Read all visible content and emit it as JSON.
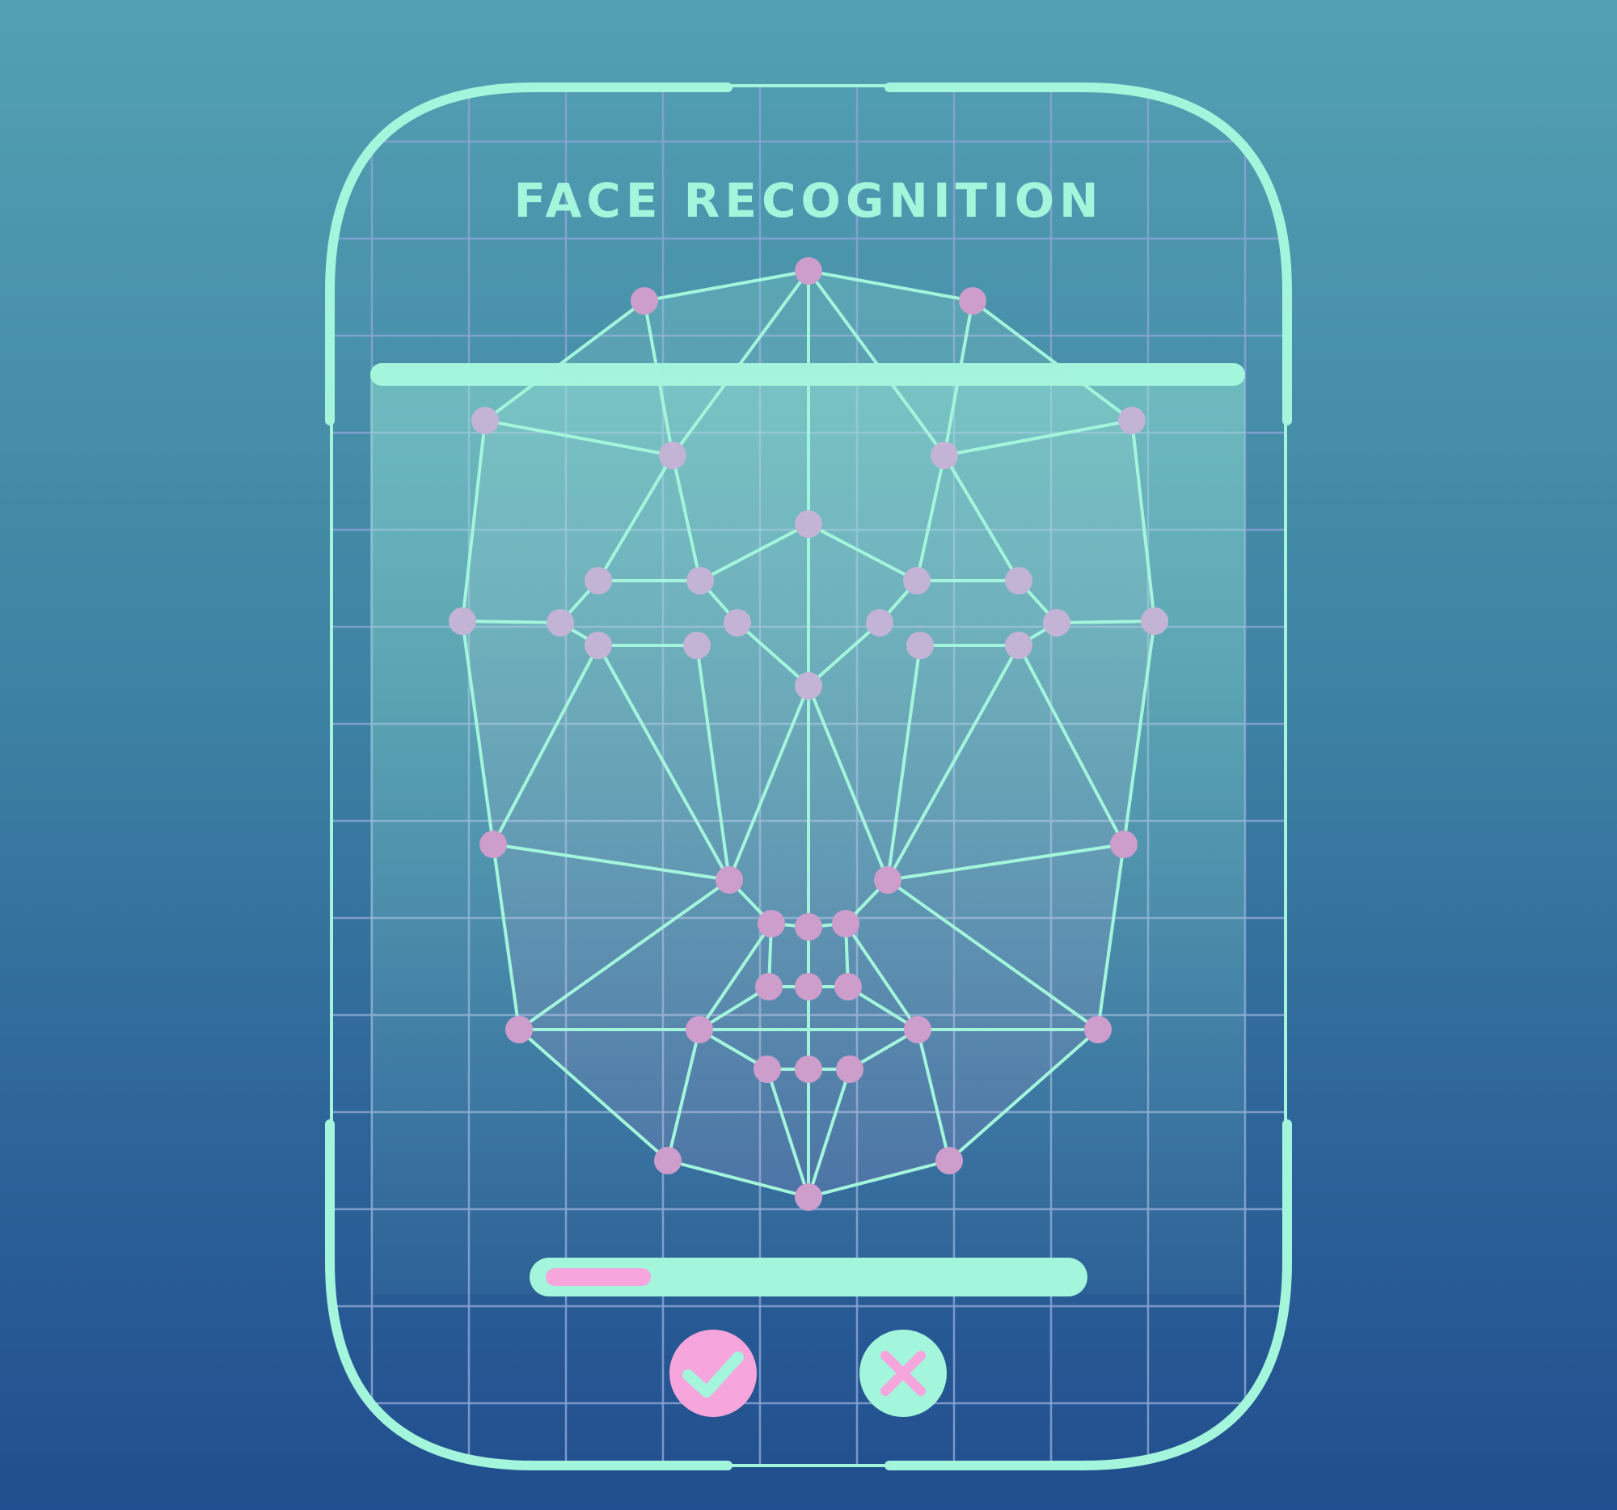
{
  "header": {
    "title": "FACE RECOGNITION"
  },
  "scan": {
    "progress": 0.2
  },
  "actions": {
    "confirm_icon": "check-icon",
    "cancel_icon": "x-icon"
  },
  "colors": {
    "frame": "#a3f6dc",
    "grid": "#8aa3d2",
    "mesh_line": "#a3f6dc",
    "node_upper": "#c3b4d6",
    "node_lower": "#cd9dcc",
    "accent_pink": "#f6a6dc",
    "scan_band": "#a3f6dc"
  }
}
